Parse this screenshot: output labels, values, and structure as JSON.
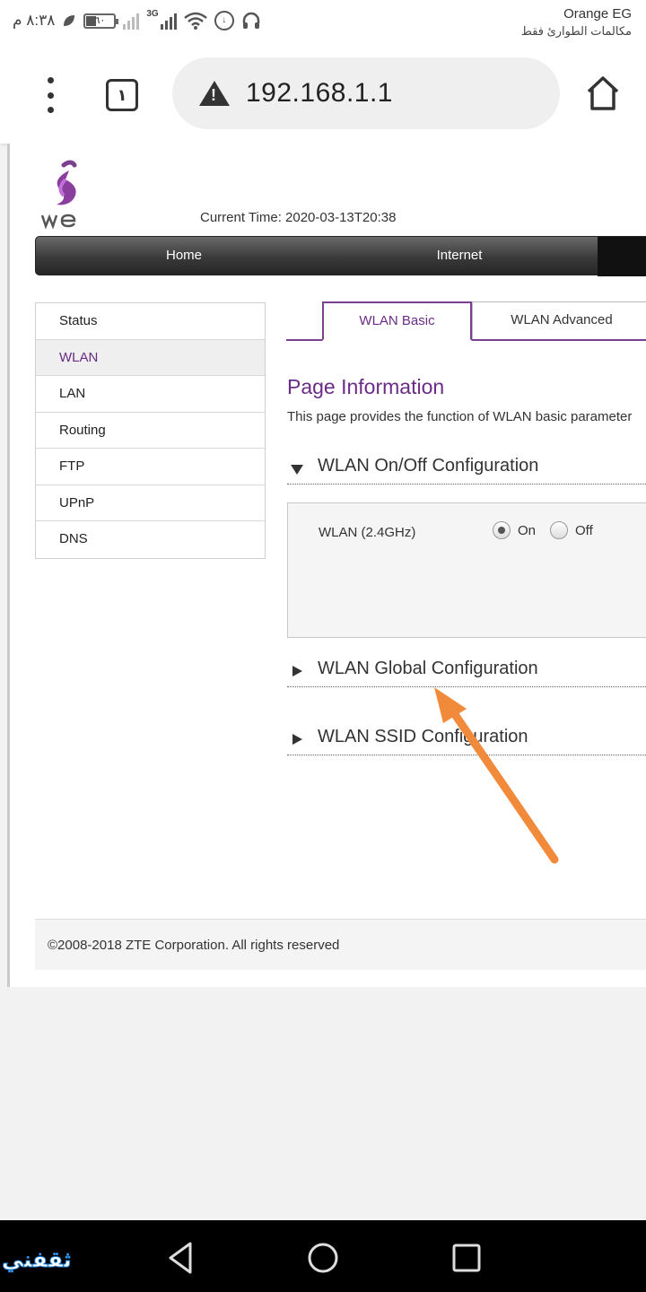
{
  "status_bar": {
    "carrier": "Orange EG",
    "carrier_sub": "مكالمات الطوارئ فقط",
    "time": "٨:٣٨ م",
    "battery": "٦٠",
    "network_type": "3G"
  },
  "browser": {
    "tab_count": "١",
    "url": "192.168.1.1"
  },
  "header": {
    "current_time": "Current Time: 2020-03-13T20:38"
  },
  "top_nav": {
    "items": [
      "Home",
      "Internet"
    ]
  },
  "sidebar": {
    "items": [
      "Status",
      "WLAN",
      "LAN",
      "Routing",
      "FTP",
      "UPnP",
      "DNS"
    ],
    "active": "WLAN"
  },
  "tabs": {
    "items": [
      "WLAN Basic",
      "WLAN Advanced"
    ],
    "active": "WLAN Basic"
  },
  "page_info": {
    "title": "Page Information",
    "description": "This page provides the function of WLAN basic parameter"
  },
  "sections": {
    "onoff": "WLAN On/Off Configuration",
    "global": "WLAN Global Configuration",
    "ssid": "WLAN SSID Configuration"
  },
  "wlan_config": {
    "label": "WLAN (2.4GHz)",
    "on_label": "On",
    "off_label": "Off",
    "selected": "On"
  },
  "footer": {
    "copyright": "©2008-2018 ZTE Corporation. All rights reserved"
  },
  "watermark": "ثقفني",
  "colors": {
    "accent_purple": "#6a2c86",
    "annotation_arrow": "#f28a3c"
  }
}
